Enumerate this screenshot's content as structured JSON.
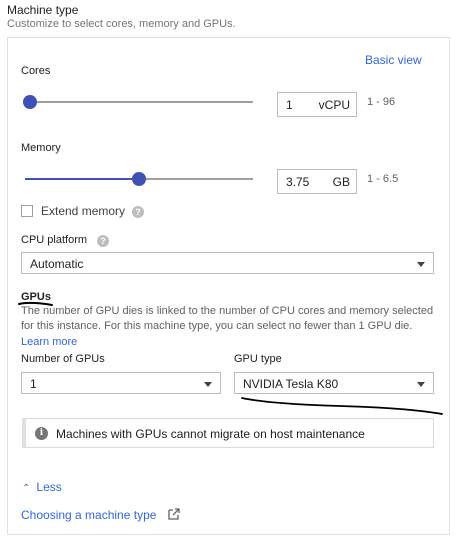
{
  "header": {
    "title": "Machine type",
    "subtitle": "Customize to select cores, memory and GPUs."
  },
  "basic_view_label": "Basic view",
  "cores": {
    "label": "Cores",
    "value": "1",
    "unit": "vCPU",
    "range": "1 - 96",
    "slider_fraction": 0.0
  },
  "memory": {
    "label": "Memory",
    "value": "3.75",
    "unit": "GB",
    "range": "1 - 6.5",
    "slider_fraction": 0.5
  },
  "extend_memory": {
    "label": "Extend memory",
    "checked": false,
    "help_icon": "help-icon"
  },
  "cpu_platform": {
    "label": "CPU platform",
    "selected": "Automatic",
    "help_icon": "help-icon"
  },
  "gpus": {
    "title": "GPUs",
    "description": "The number of GPU dies is linked to the number of CPU cores and memory selected for this instance. For this machine type, you can select no fewer than 1 GPU die.",
    "learn_more": "Learn more",
    "number_label": "Number of GPUs",
    "number_selected": "1",
    "type_label": "GPU type",
    "type_selected": "NVIDIA Tesla K80"
  },
  "notice": {
    "icon": "info-icon",
    "text": "Machines with GPUs cannot migrate on host maintenance"
  },
  "less_label": "Less",
  "choosing_link": "Choosing a machine type",
  "colors": {
    "accent": "#3f51b5",
    "link": "#3367d6",
    "annotation": "#000000"
  }
}
